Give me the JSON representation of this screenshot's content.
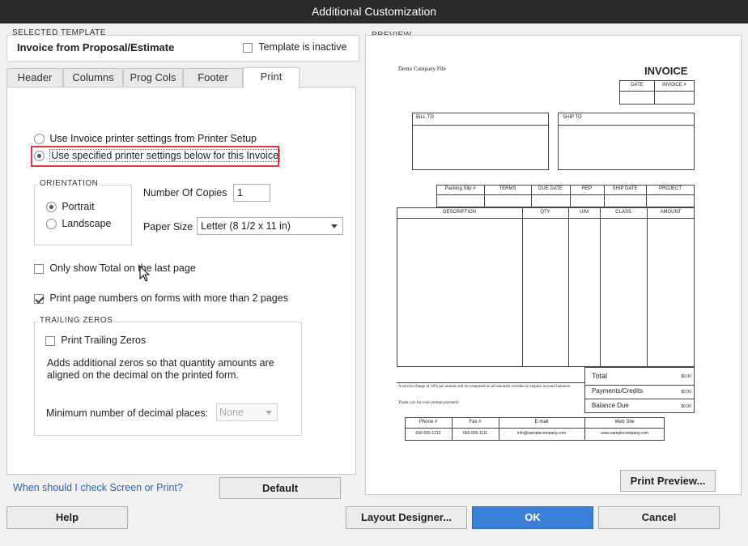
{
  "window": {
    "title": "Additional Customization"
  },
  "template": {
    "group_label": "SELECTED TEMPLATE",
    "name": "Invoice from Proposal/Estimate",
    "inactive_label": "Template is inactive"
  },
  "tabs": [
    {
      "label": "Header"
    },
    {
      "label": "Columns"
    },
    {
      "label": "Prog Cols"
    },
    {
      "label": "Footer"
    },
    {
      "label": "Print"
    }
  ],
  "print": {
    "radio1_label": "Use Invoice printer settings from Printer Setup",
    "radio2_label": "Use specified printer settings below for this Invoice",
    "orientation_label": "ORIENTATION",
    "portrait_label": "Portrait",
    "landscape_label": "Landscape",
    "copies_label": "Number Of Copies",
    "copies_value": "1",
    "paper_label": "Paper Size",
    "paper_value": "Letter (8 1/2 x 11 in)",
    "only_total_label": "Only show Total on the last page",
    "page_numbers_label": "Print page numbers on forms with more than 2 pages",
    "trailing_group_label": "TRAILING ZEROS",
    "trailing_label": "Print Trailing Zeros",
    "trailing_desc1": "Adds additional zeros so that quantity amounts are",
    "trailing_desc2": "aligned on the decimal on the printed form.",
    "decimal_label": "Minimum number of decimal places:",
    "decimal_value": "None"
  },
  "help_link": "When should I check Screen or Print?",
  "default_button": "Default",
  "preview": {
    "group_label": "PREVIEW",
    "company": "Demo Company File",
    "invoice_title": "INVOICE",
    "date_col": "DATE",
    "invoice_no_col": "INVOICE #",
    "bill_to": "BILL TO",
    "ship_to": "SHIP TO",
    "info_cols": [
      "Packing Slip #",
      "TERMS",
      "DUE DATE",
      "REP",
      "SHIP DATE",
      "PROJECT"
    ],
    "line_cols": [
      "DESCRIPTION",
      "QTY",
      "U/M",
      "CLASS",
      "AMOUNT"
    ],
    "note1": "A service charge of 18% per annum will be computed on all amounts overdue on regular account balances",
    "note2": "Thank you for your prompt payment!",
    "total_label": "Total",
    "payments_label": "Payments/Credits",
    "balance_label": "Balance Due",
    "zero_amount": "$0.00",
    "footer_cols": [
      "Phone #",
      "Fax #",
      "E-mail",
      "Web Site"
    ],
    "footer_vals": [
      "650-555-1212",
      "650-555-1111",
      "info@samplecompany.com",
      "www.samplecompany.com"
    ],
    "print_preview_button": "Print Preview..."
  },
  "buttons": {
    "help": "Help",
    "layout_designer": "Layout Designer...",
    "ok": "OK",
    "cancel": "Cancel"
  },
  "colors": {
    "highlight": "#e0393e",
    "ok_button": "#3a7fd8",
    "titlebar": "#2b2b2b"
  }
}
